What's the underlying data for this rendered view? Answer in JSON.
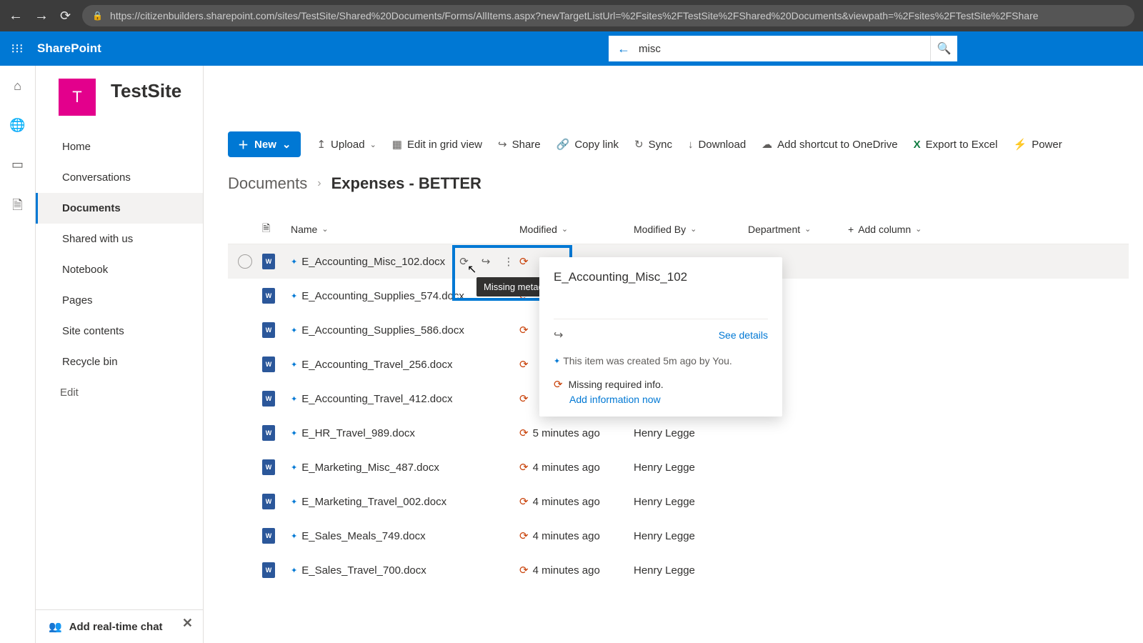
{
  "browser": {
    "url": "https://citizenbuilders.sharepoint.com/sites/TestSite/Shared%20Documents/Forms/AllItems.aspx?newTargetListUrl=%2Fsites%2FTestSite%2FShared%20Documents&viewpath=%2Fsites%2FTestSite%2FShare"
  },
  "header": {
    "brand": "SharePoint",
    "search_value": "misc"
  },
  "site": {
    "logo_letter": "T",
    "title": "TestSite"
  },
  "nav": {
    "items": [
      "Home",
      "Conversations",
      "Documents",
      "Shared with us",
      "Notebook",
      "Pages",
      "Site contents",
      "Recycle bin"
    ],
    "active_index": 2,
    "edit": "Edit",
    "chat_promo": "Add real-time chat"
  },
  "commands": {
    "new": "New",
    "upload": "Upload",
    "edit_grid": "Edit in grid view",
    "share": "Share",
    "copy_link": "Copy link",
    "sync": "Sync",
    "download": "Download",
    "shortcut": "Add shortcut to OneDrive",
    "export": "Export to Excel",
    "power": "Power"
  },
  "breadcrumb": {
    "root": "Documents",
    "current": "Expenses - BETTER"
  },
  "columns": {
    "name": "Name",
    "modified": "Modified",
    "modified_by": "Modified By",
    "department": "Department",
    "add": "Add column"
  },
  "rows": [
    {
      "name": "E_Accounting_Misc_102.docx",
      "modified": "",
      "by": ""
    },
    {
      "name": "E_Accounting_Supplies_574.docx",
      "modified": "",
      "by": ""
    },
    {
      "name": "E_Accounting_Supplies_586.docx",
      "modified": "",
      "by": ""
    },
    {
      "name": "E_Accounting_Travel_256.docx",
      "modified": "",
      "by": ""
    },
    {
      "name": "E_Accounting_Travel_412.docx",
      "modified": "",
      "by": ""
    },
    {
      "name": "E_HR_Travel_989.docx",
      "modified": "5 minutes ago",
      "by": "Henry Legge"
    },
    {
      "name": "E_Marketing_Misc_487.docx",
      "modified": "4 minutes ago",
      "by": "Henry Legge"
    },
    {
      "name": "E_Marketing_Travel_002.docx",
      "modified": "4 minutes ago",
      "by": "Henry Legge"
    },
    {
      "name": "E_Sales_Meals_749.docx",
      "modified": "4 minutes ago",
      "by": "Henry Legge"
    },
    {
      "name": "E_Sales_Travel_700.docx",
      "modified": "4 minutes ago",
      "by": "Henry Legge"
    }
  ],
  "tooltip": "Missing metadata",
  "hover_card": {
    "title": "E_Accounting_Misc_102",
    "see_details": "See details",
    "created": "This item was created 5m ago by You.",
    "missing": "Missing required info.",
    "add_info": "Add information now"
  }
}
